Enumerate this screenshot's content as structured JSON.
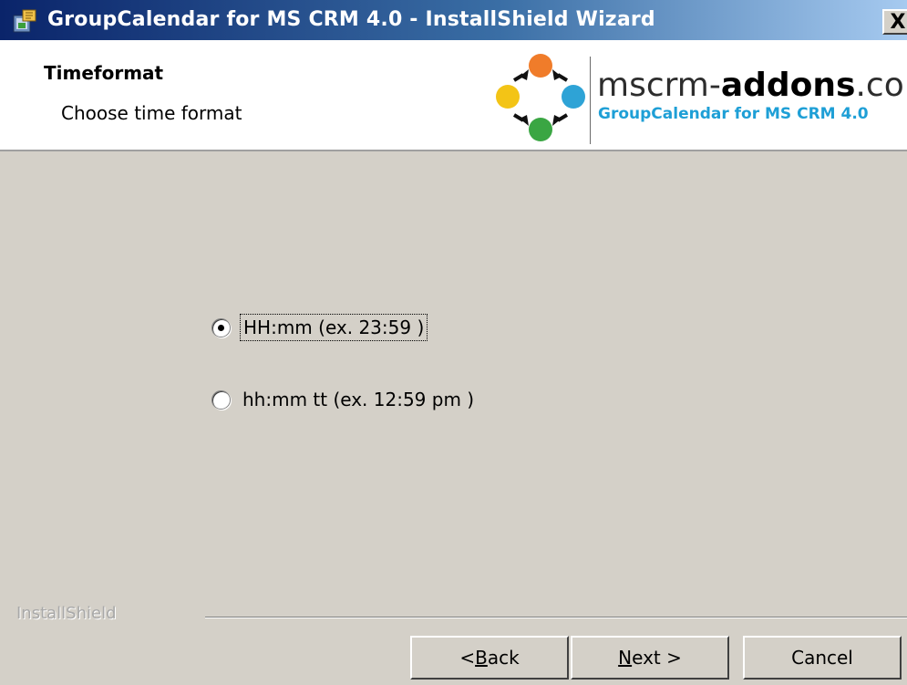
{
  "window": {
    "title": "GroupCalendar for MS CRM 4.0 - InstallShield Wizard",
    "close_label": "X"
  },
  "header": {
    "title": "Timeformat",
    "subtitle": "Choose time format",
    "logo": {
      "brand_prefix": "mscrm-",
      "brand_bold": "addons",
      "brand_suffix": ".com",
      "tagline": "GroupCalendar for MS CRM 4.0"
    }
  },
  "options": [
    {
      "label": "HH:mm (ex. 23:59 )",
      "selected": true
    },
    {
      "label": "hh:mm tt (ex. 12:59 pm )",
      "selected": false
    }
  ],
  "footer": {
    "brand": "InstallShield",
    "back": {
      "underline": "B",
      "rest": "ack",
      "prefix": "< "
    },
    "next": {
      "underline": "N",
      "rest": "ext >"
    },
    "cancel": "Cancel"
  },
  "colors": {
    "dialog_bg": "#d4d0c8",
    "title_start": "#0a246a",
    "title_end": "#a6caf0",
    "tagline": "#1e9fd6"
  }
}
